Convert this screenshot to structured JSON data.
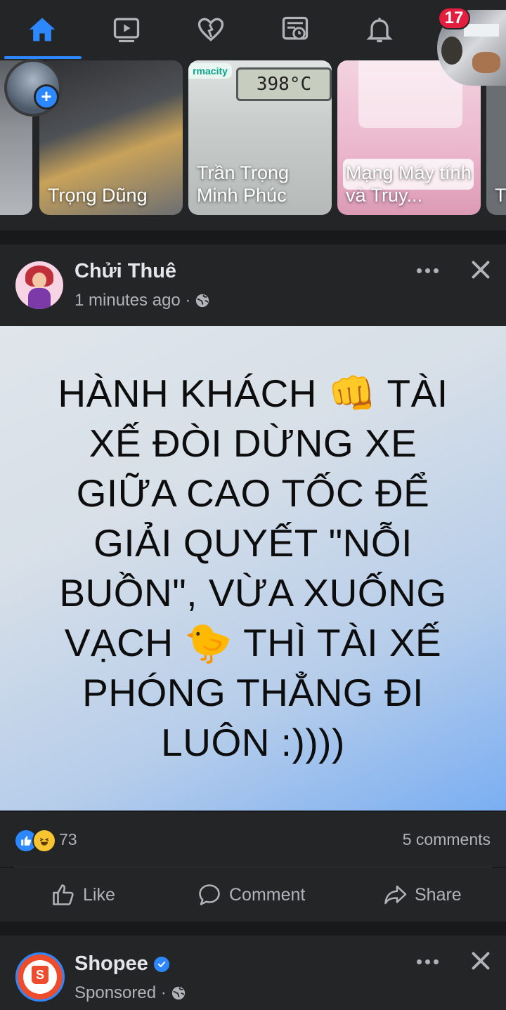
{
  "nav": {
    "items": [
      {
        "icon": "home-icon",
        "active": true
      },
      {
        "icon": "watch-icon",
        "active": false
      },
      {
        "icon": "heart-icon",
        "active": false
      },
      {
        "icon": "feeds-icon",
        "active": false
      },
      {
        "icon": "bell-icon",
        "active": false
      }
    ],
    "badge": "17",
    "accent": "#2d88ff"
  },
  "stories": [
    {
      "label": ""
    },
    {
      "label": "Trọng Dũng"
    },
    {
      "label": "Trần Trọng Minh Phúc",
      "overlay_text": "398°C",
      "brand": "rmacity"
    },
    {
      "label": "Mạng Máy tính và Truy..."
    },
    {
      "label": "T H"
    }
  ],
  "post": {
    "author": "Chửi Thuê",
    "time": "1 minutes ago · ",
    "text": "HÀNH KHÁCH 👊 TÀI XẾ ĐÒI DỪNG XE GIỮA CAO TỐC ĐỂ GIẢI QUYẾT \"NỖI BUỒN\", VỪA XUỐNG VẠCH 🐤 THÌ TÀI XẾ PHÓNG THẲNG ĐI LUÔN :))))",
    "reaction_count": "73",
    "comments": "5 comments",
    "actions": {
      "like": "Like",
      "comment": "Comment",
      "share": "Share"
    }
  },
  "sponsored": {
    "name": "Shopee",
    "meta": "Sponsored · ",
    "logo_letter": "S"
  }
}
